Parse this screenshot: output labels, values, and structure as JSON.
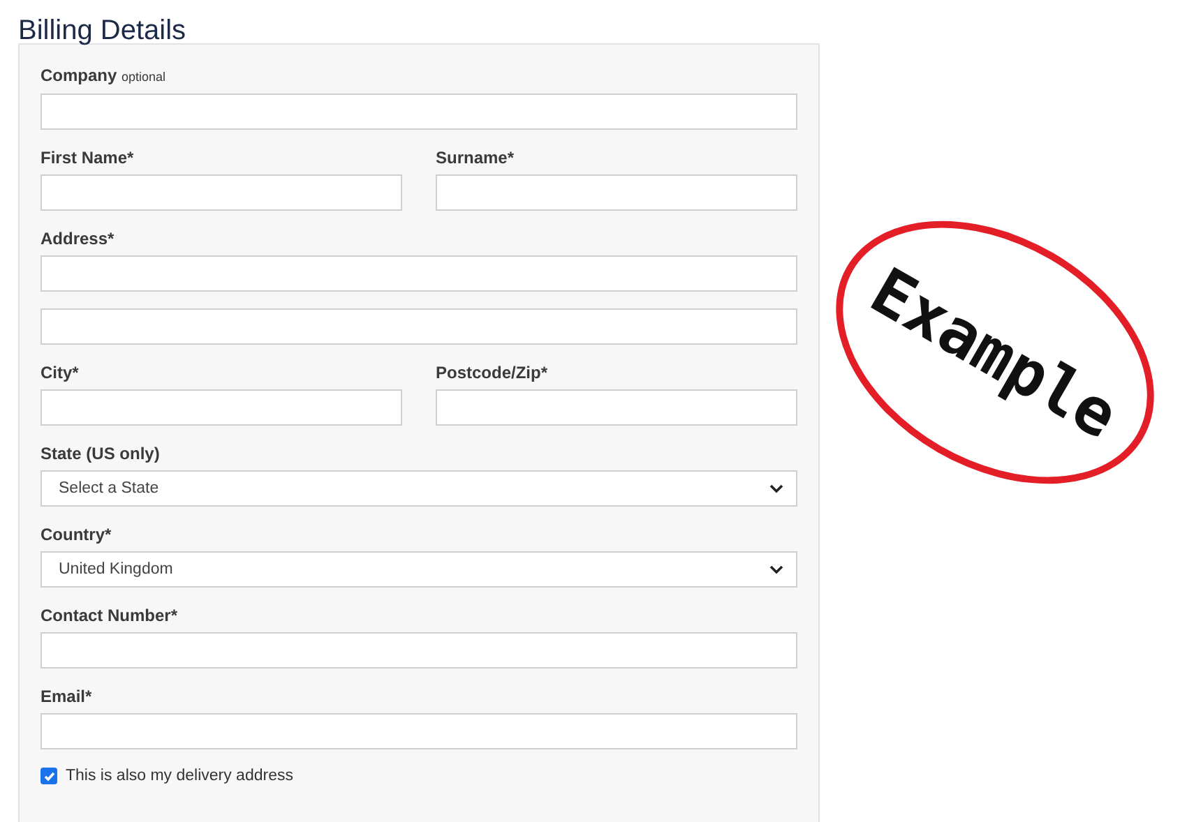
{
  "title": "Billing Details",
  "rows": [
    {
      "fields": [
        {
          "kind": "text",
          "label": "Company",
          "hint": "optional"
        }
      ]
    },
    {
      "fields": [
        {
          "kind": "text",
          "label": "First Name*"
        },
        {
          "kind": "text",
          "label": "Surname*"
        }
      ]
    },
    {
      "fields": [
        {
          "kind": "text",
          "label": "Address*"
        }
      ]
    },
    {
      "fields": [
        {
          "kind": "text"
        }
      ]
    },
    {
      "fields": [
        {
          "kind": "text",
          "label": "City*"
        },
        {
          "kind": "text",
          "label": "Postcode/Zip*"
        }
      ]
    },
    {
      "fields": [
        {
          "kind": "select",
          "label": "State (US only)",
          "value": "Select a State"
        }
      ]
    },
    {
      "fields": [
        {
          "kind": "select",
          "label": "Country*",
          "value": "United Kingdom"
        }
      ]
    },
    {
      "fields": [
        {
          "kind": "text",
          "label": "Contact Number*"
        }
      ]
    },
    {
      "fields": [
        {
          "kind": "text",
          "label": "Email*"
        }
      ]
    }
  ],
  "delivery": {
    "label": "This is also my delivery address",
    "checked": true
  },
  "stamp": {
    "text": "Example"
  }
}
